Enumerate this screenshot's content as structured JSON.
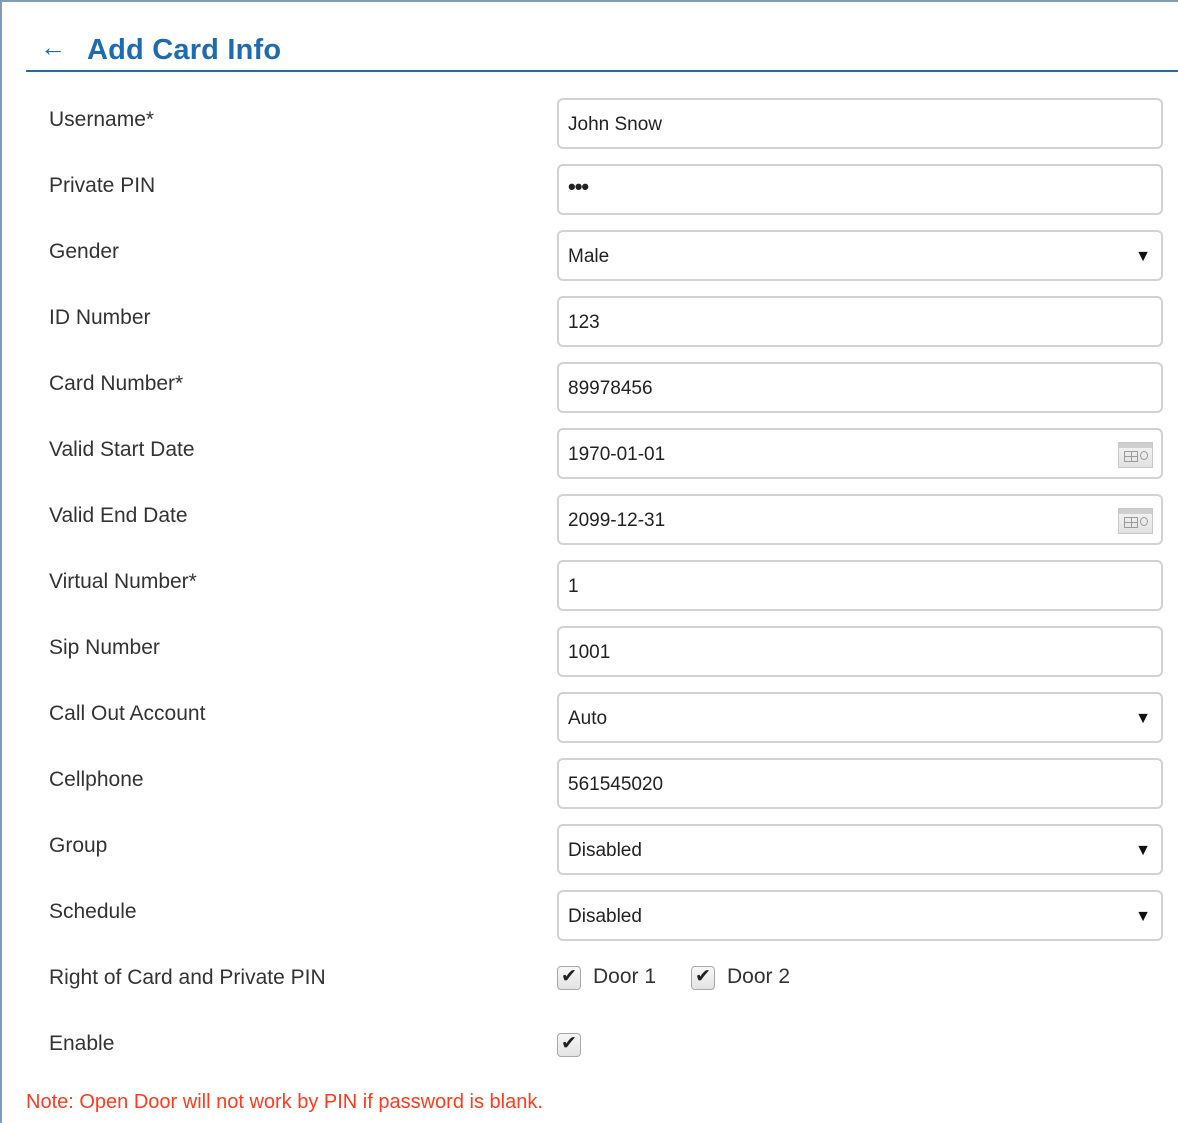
{
  "header": {
    "back_icon": "arrow-left-icon",
    "title": "Add Card Info"
  },
  "form": {
    "username": {
      "label": "Username*",
      "value": "John Snow"
    },
    "private_pin": {
      "label": "Private PIN",
      "value": "•••"
    },
    "gender": {
      "label": "Gender",
      "value": "Male"
    },
    "id_number": {
      "label": "ID Number",
      "value": "123"
    },
    "card_number": {
      "label": "Card Number*",
      "value": "89978456"
    },
    "valid_start_date": {
      "label": "Valid Start Date",
      "value": "1970-01-01",
      "icon": "calendar-icon"
    },
    "valid_end_date": {
      "label": "Valid End Date",
      "value": "2099-12-31",
      "icon": "calendar-icon"
    },
    "virtual_number": {
      "label": "Virtual Number*",
      "value": "1"
    },
    "sip_number": {
      "label": "Sip Number",
      "value": "1001"
    },
    "call_out_account": {
      "label": "Call Out Account",
      "value": "Auto"
    },
    "cellphone": {
      "label": "Cellphone",
      "value": "561545020"
    },
    "group": {
      "label": "Group",
      "value": "Disabled"
    },
    "schedule": {
      "label": "Schedule",
      "value": "Disabled"
    },
    "right_of_card": {
      "label": "Right of Card and Private PIN",
      "door1": {
        "label": "Door 1",
        "checked": true
      },
      "door2": {
        "label": "Door 2",
        "checked": true
      }
    },
    "enable": {
      "label": "Enable",
      "checked": true
    }
  },
  "dropdown_arrow": "▼",
  "check_mark": "✔",
  "note": "Note: Open Door will not work by PIN if password is blank.",
  "colors": {
    "accent": "#1f6bb0",
    "note": "#ff3b1f",
    "field_border": "#d2d2d2"
  }
}
